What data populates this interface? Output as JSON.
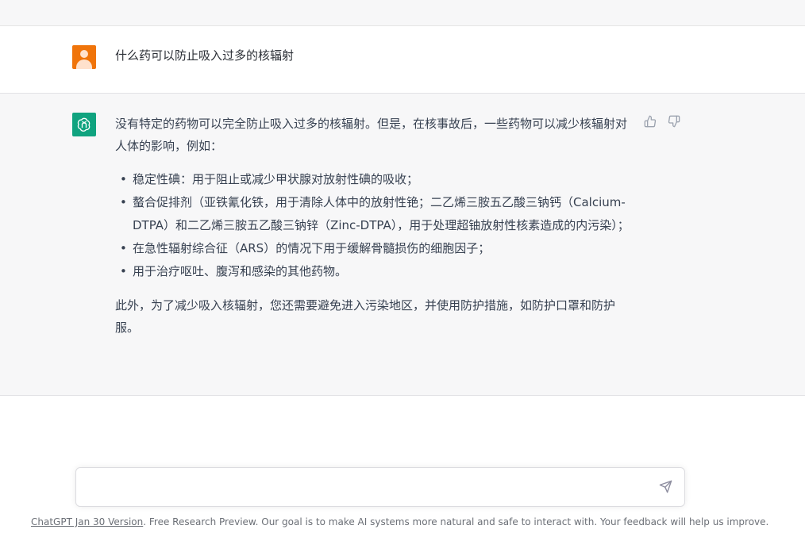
{
  "conversation": {
    "user_message": "什么药可以防止吸入过多的核辐射",
    "assistant": {
      "intro": "没有特定的药物可以完全防止吸入过多的核辐射。但是，在核事故后，一些药物可以减少核辐射对人体的影响，例如：",
      "items": [
        "稳定性碘：用于阻止或减少甲状腺对放射性碘的吸收；",
        "螯合促排剂（亚铁氰化铁，用于清除人体中的放射性铯；二乙烯三胺五乙酸三钠钙（Calcium-DTPA）和二乙烯三胺五乙酸三钠锌（Zinc-DTPA），用于处理超铀放射性核素造成的内污染）；",
        "在急性辐射综合征（ARS）的情况下用于缓解骨髓损伤的细胞因子；",
        "用于治疗呕吐、腹泻和感染的其他药物。"
      ],
      "outro": "此外，为了减少吸入核辐射，您还需要避免进入污染地区，并使用防护措施，如防护口罩和防护服。"
    }
  },
  "icons": {
    "user_avatar": "user-avatar-icon",
    "assistant_avatar": "openai-logo-icon",
    "thumbs_up": "thumbs-up-icon",
    "thumbs_down": "thumbs-down-icon",
    "send": "send-icon"
  },
  "input": {
    "value": "",
    "placeholder": ""
  },
  "footer": {
    "link_text": "ChatGPT Jan 30 Version",
    "text": ". Free Research Preview. Our goal is to make AI systems more natural and safe to interact with. Your feedback will help us improve."
  },
  "colors": {
    "user_avatar": "#f0740a",
    "assistant_avatar": "#10a37f",
    "assistant_bg": "#f7f7f8"
  }
}
